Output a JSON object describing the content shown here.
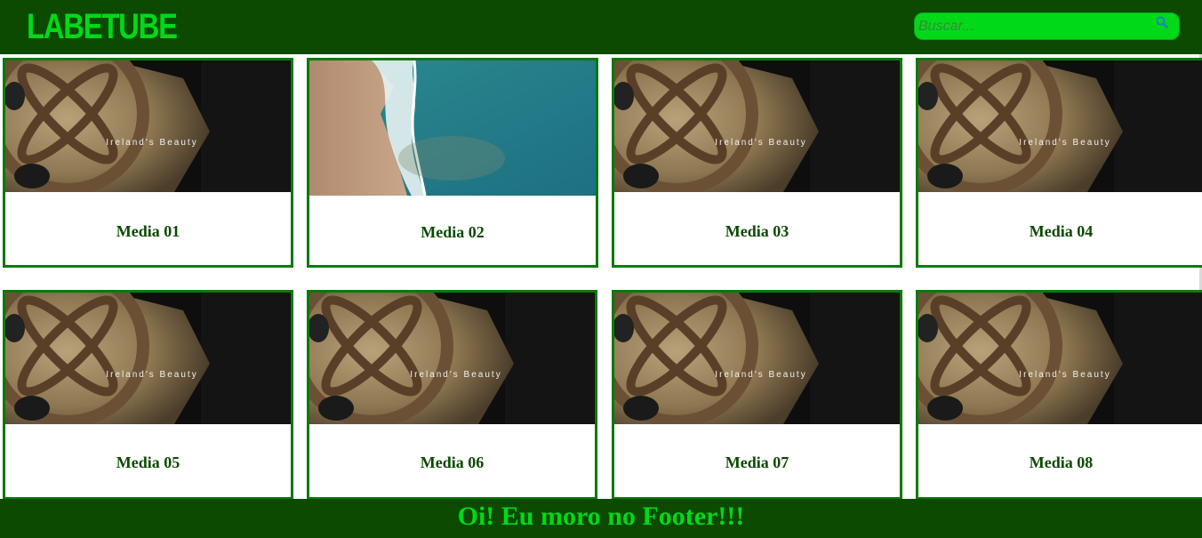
{
  "header": {
    "logo": "LABETUBE",
    "search_placeholder": "Buscar..."
  },
  "videos": [
    {
      "title": "Media 01",
      "thumbnail_text": "Ireland's Beauty",
      "thumbnail": "celtic-cross"
    },
    {
      "title": "Media 02",
      "thumbnail_text": "",
      "thumbnail": "beach-aerial"
    },
    {
      "title": "Media 03",
      "thumbnail_text": "Ireland's Beauty",
      "thumbnail": "celtic-cross"
    },
    {
      "title": "Media 04",
      "thumbnail_text": "Ireland's Beauty",
      "thumbnail": "celtic-cross"
    },
    {
      "title": "Media 05",
      "thumbnail_text": "Ireland's Beauty",
      "thumbnail": "celtic-cross"
    },
    {
      "title": "Media 06",
      "thumbnail_text": "Ireland's Beauty",
      "thumbnail": "celtic-cross"
    },
    {
      "title": "Media 07",
      "thumbnail_text": "Ireland's Beauty",
      "thumbnail": "celtic-cross"
    },
    {
      "title": "Media 08",
      "thumbnail_text": "Ireland's Beauty",
      "thumbnail": "celtic-cross"
    }
  ],
  "footer": {
    "text": "Oi! Eu moro no Footer!!!"
  },
  "colors": {
    "header_bg": "#0b4a00",
    "accent": "#00d918",
    "card_border": "#0a7a0a"
  }
}
